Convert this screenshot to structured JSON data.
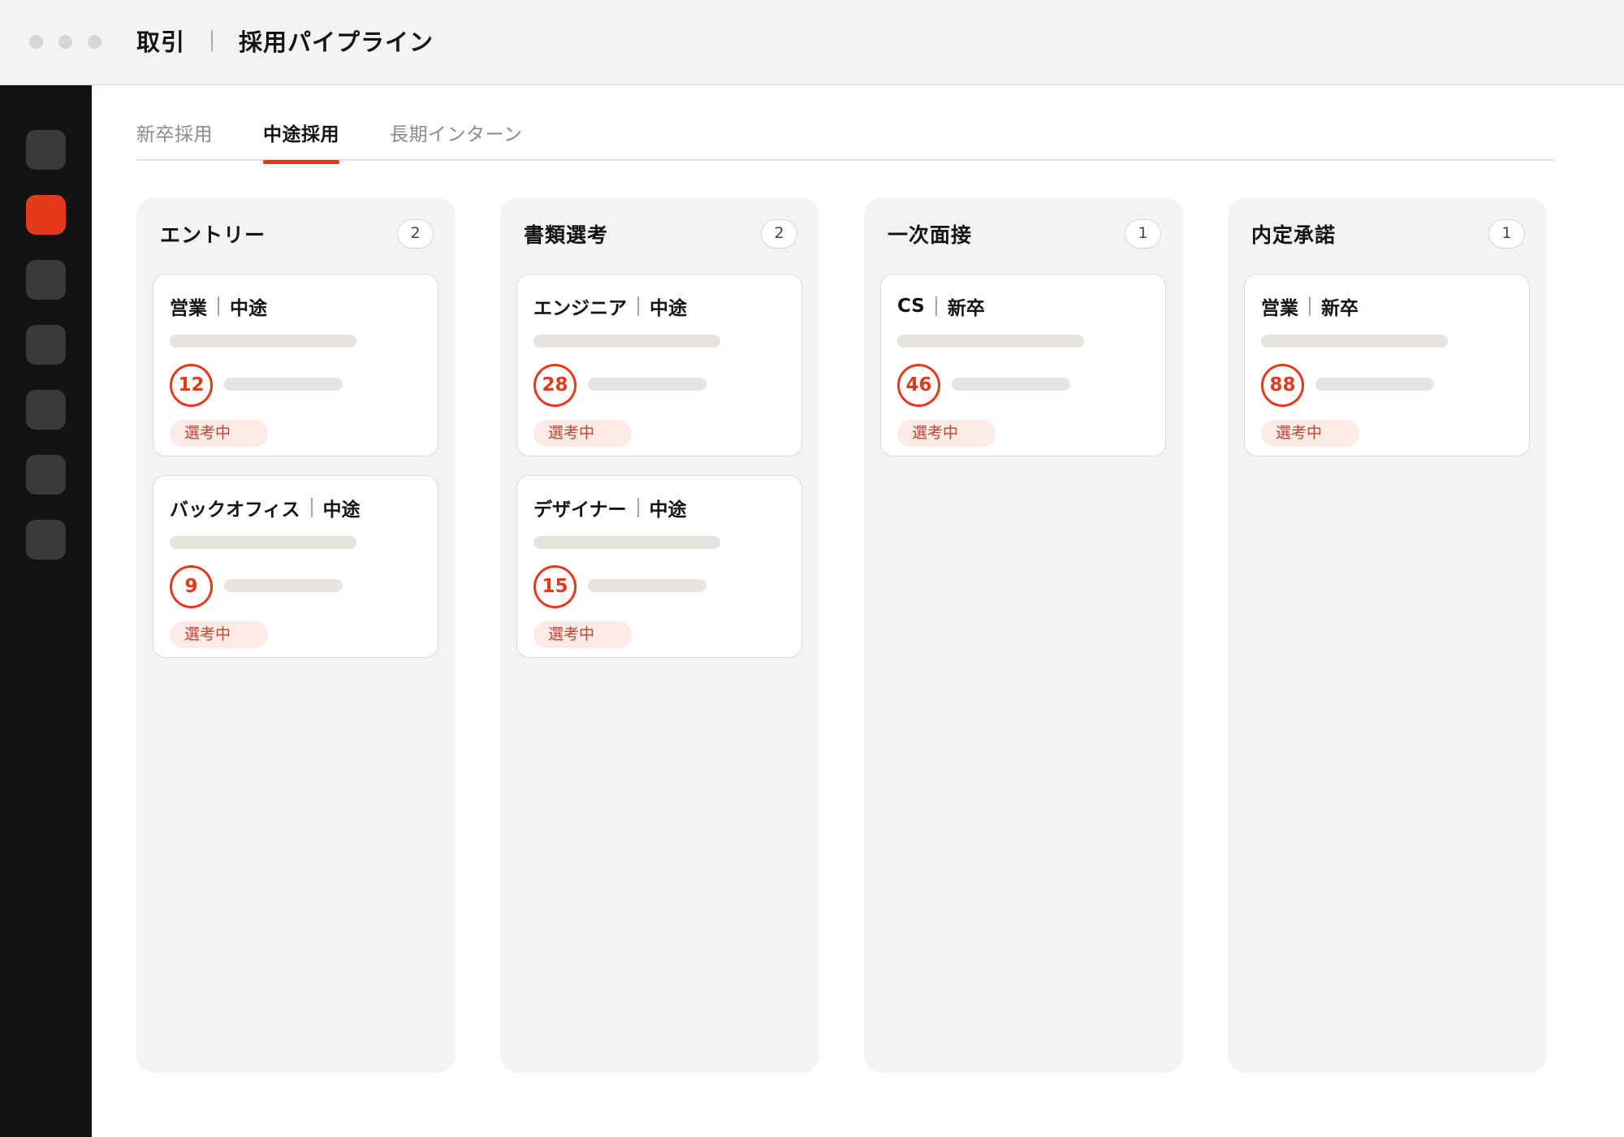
{
  "window": {
    "breadcrumb": [
      "取引",
      "採用パイプライン"
    ]
  },
  "sidebar": {
    "items": [
      {
        "name": "nav-1",
        "active": false
      },
      {
        "name": "nav-2",
        "active": true
      },
      {
        "name": "nav-3",
        "active": false
      },
      {
        "name": "nav-4",
        "active": false
      },
      {
        "name": "nav-5",
        "active": false
      },
      {
        "name": "nav-6",
        "active": false
      },
      {
        "name": "nav-7",
        "active": false
      }
    ]
  },
  "tabs": [
    {
      "label": "新卒採用",
      "active": false
    },
    {
      "label": "中途採用",
      "active": true
    },
    {
      "label": "長期インターン",
      "active": false
    }
  ],
  "columns": [
    {
      "title": "エントリー",
      "count": "2",
      "cards": [
        {
          "role": "営業",
          "type": "中途",
          "score": "12",
          "status": "選考中"
        },
        {
          "role": "バックオフィス",
          "type": "中途",
          "score": "9",
          "status": "選考中"
        }
      ]
    },
    {
      "title": "書類選考",
      "count": "2",
      "cards": [
        {
          "role": "エンジニア",
          "type": "中途",
          "score": "28",
          "status": "選考中"
        },
        {
          "role": "デザイナー",
          "type": "中途",
          "score": "15",
          "status": "選考中"
        }
      ]
    },
    {
      "title": "一次面接",
      "count": "1",
      "cards": [
        {
          "role": "CS",
          "type": "新卒",
          "score": "46",
          "status": "選考中"
        }
      ]
    },
    {
      "title": "内定承諾",
      "count": "1",
      "cards": [
        {
          "role": "営業",
          "type": "新卒",
          "score": "88",
          "status": "選考中"
        }
      ]
    }
  ],
  "colors": {
    "accent": "#e33a1c",
    "sidebar": "#121212",
    "column_bg": "#f4f3f1",
    "badge_bg": "#fceae5"
  }
}
